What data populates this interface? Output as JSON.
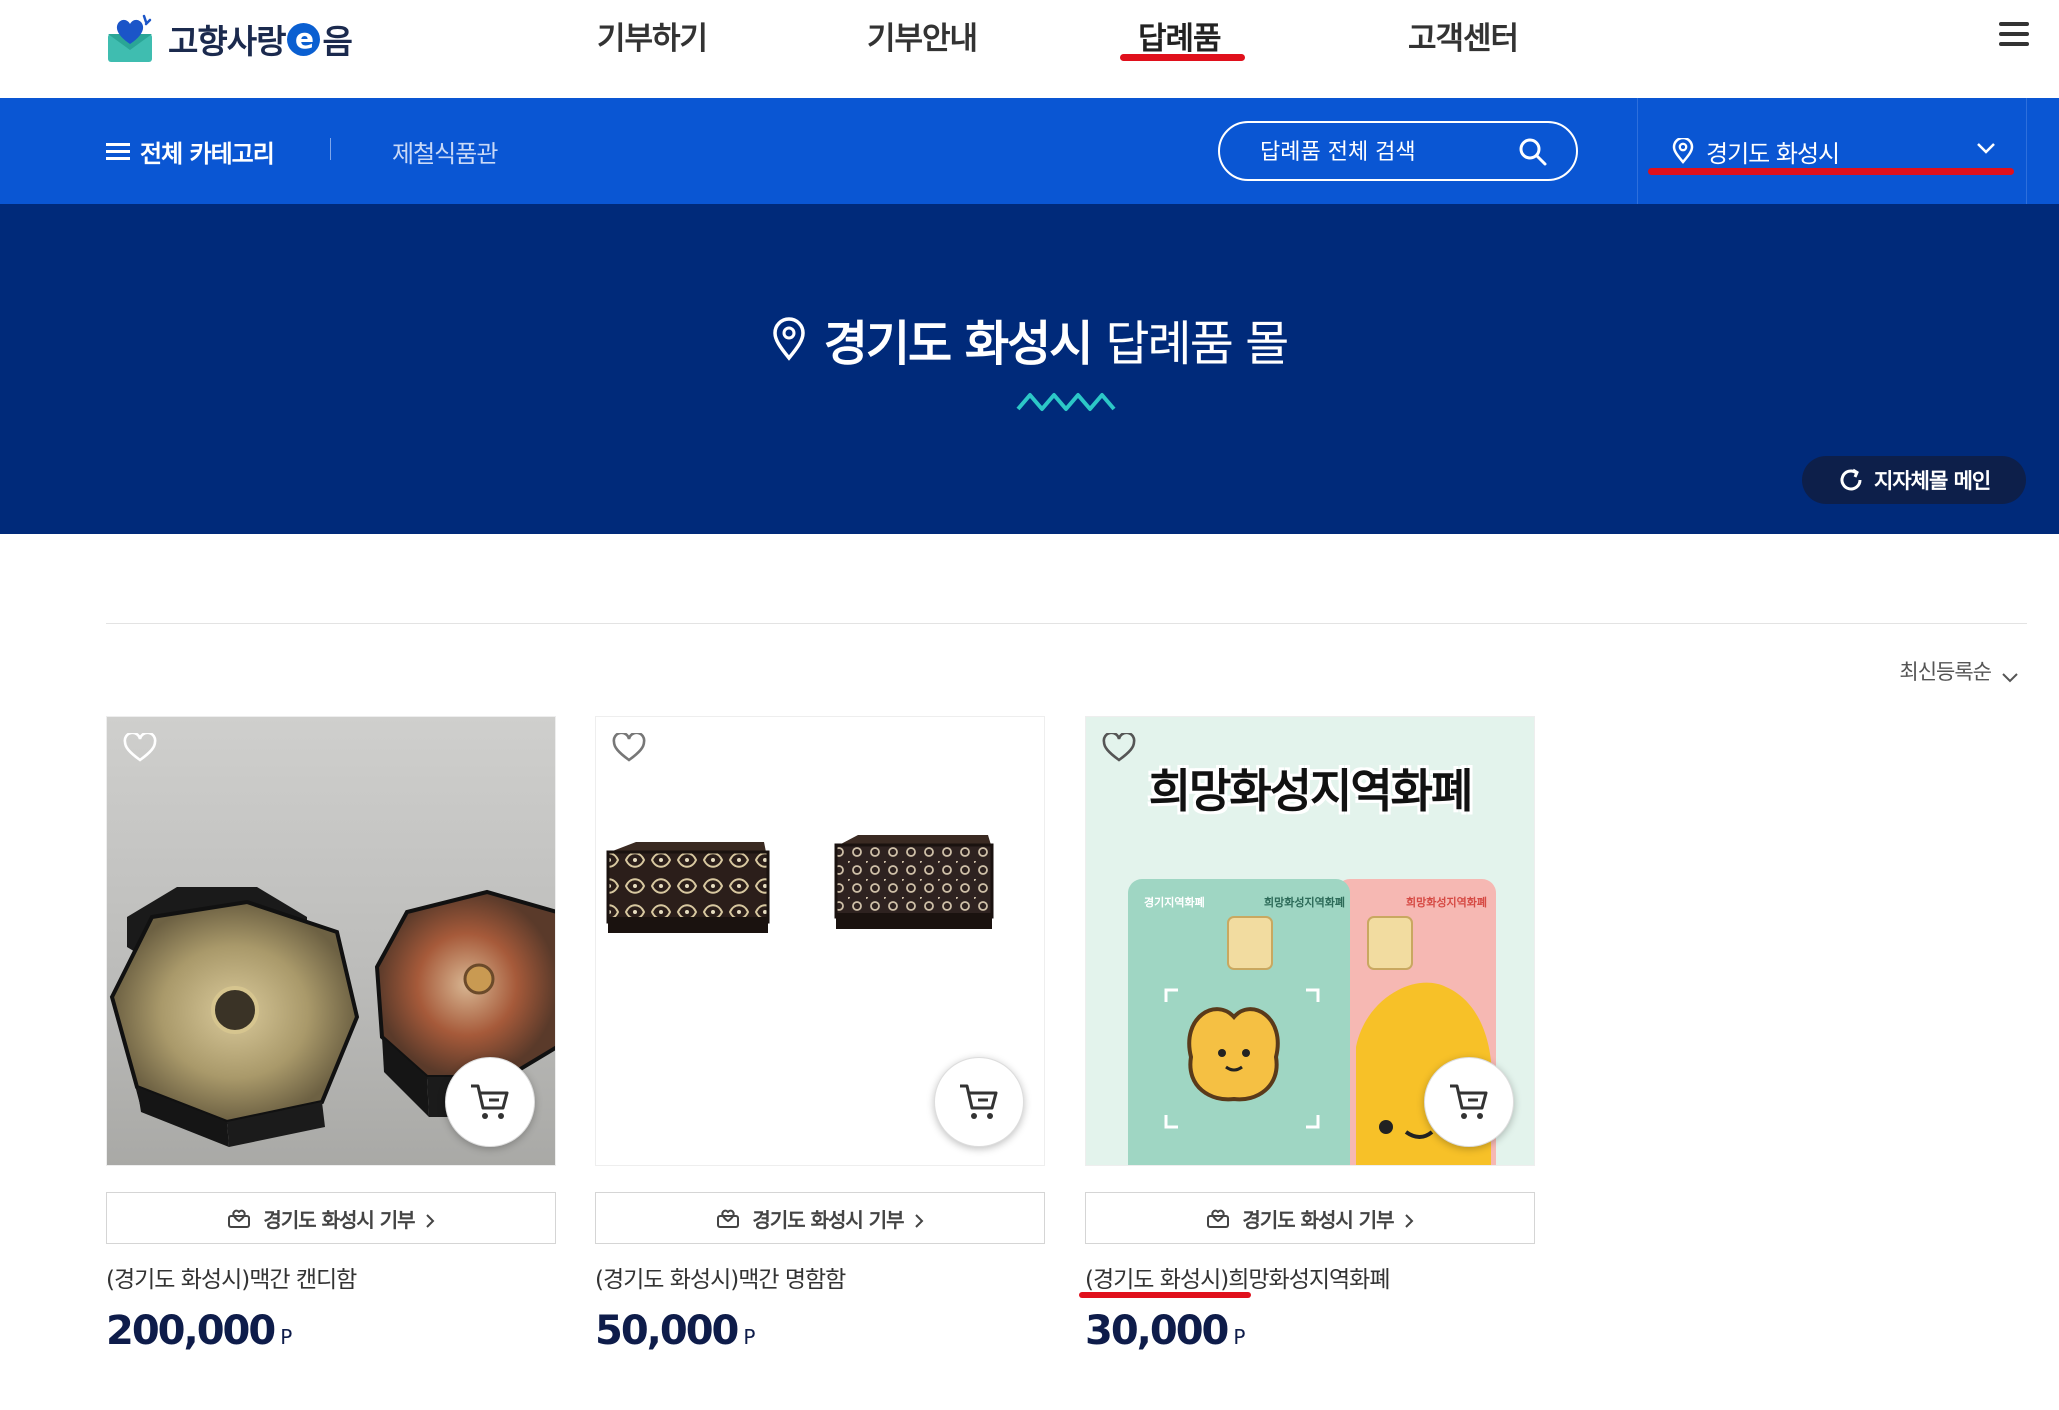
{
  "header": {
    "logo_text_1": "고향사랑",
    "logo_e": "e",
    "logo_text_2": "음",
    "nav": [
      {
        "label": "기부하기"
      },
      {
        "label": "기부안내"
      },
      {
        "label": "답례품"
      },
      {
        "label": "고객센터"
      }
    ],
    "active_nav": "답례품"
  },
  "subbar": {
    "category_label": "전체 카테고리",
    "sub_link": "제철식품관",
    "search_placeholder": "답례품 전체 검색",
    "region": "경기도 화성시"
  },
  "hero": {
    "region": "경기도 화성시",
    "suffix": "답례품 몰",
    "main_button": "지자체몰 메인"
  },
  "list": {
    "sort_label": "최신등록순",
    "products": [
      {
        "donate_label": "경기도 화성시 기부",
        "name": "(경기도 화성시)맥간 캔디함",
        "price": "200,000",
        "unit": "P"
      },
      {
        "donate_label": "경기도 화성시 기부",
        "name": "(경기도 화성시)맥간 명함함",
        "price": "50,000",
        "unit": "P"
      },
      {
        "donate_label": "경기도 화성시 기부",
        "name": "(경기도 화성시)희망화성지역화폐",
        "price": "30,000",
        "unit": "P",
        "image_title": "희망화성지역화폐",
        "card_texts": [
          "경기지역화폐",
          "희망화성지역화폐"
        ]
      }
    ]
  },
  "colors": {
    "brand_blue": "#0a56d3",
    "hero_navy": "#002a7a",
    "price_navy": "#0e1c4a",
    "annotation_red": "#e0101c"
  }
}
